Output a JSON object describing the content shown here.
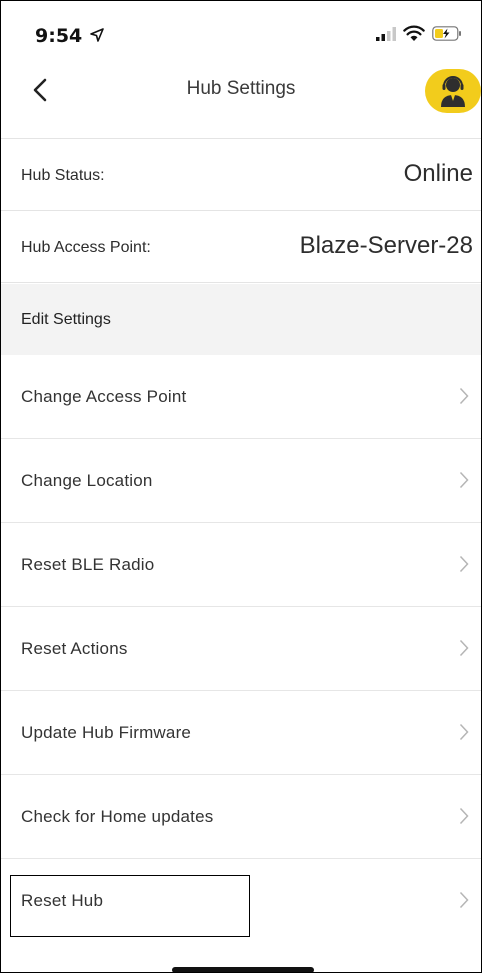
{
  "status_bar": {
    "time": "9:54",
    "icons": [
      "location-arrow-icon",
      "signal-icon",
      "wifi-icon",
      "battery-charging-icon"
    ]
  },
  "nav": {
    "title": "Hub Settings",
    "back_icon": "chevron-left-icon",
    "support_icon": "support-agent-icon",
    "support_color": "#f2cc1c"
  },
  "info": [
    {
      "label": "Hub Status:",
      "value": "Online"
    },
    {
      "label": "Hub Access Point:",
      "value": "Blaze-Server-28"
    }
  ],
  "section_header": "Edit Settings",
  "menu": [
    {
      "label": "Change Access Point"
    },
    {
      "label": "Change Location"
    },
    {
      "label": "Reset BLE Radio"
    },
    {
      "label": "Reset Actions"
    },
    {
      "label": "Update Hub Firmware"
    },
    {
      "label": "Check for Home updates"
    },
    {
      "label": "Reset Hub"
    }
  ],
  "colors": {
    "accent": "#f2cc1c",
    "section_bg": "#f3f3f3",
    "divider": "#e4e4e4",
    "chevron": "#b5b5b5"
  }
}
